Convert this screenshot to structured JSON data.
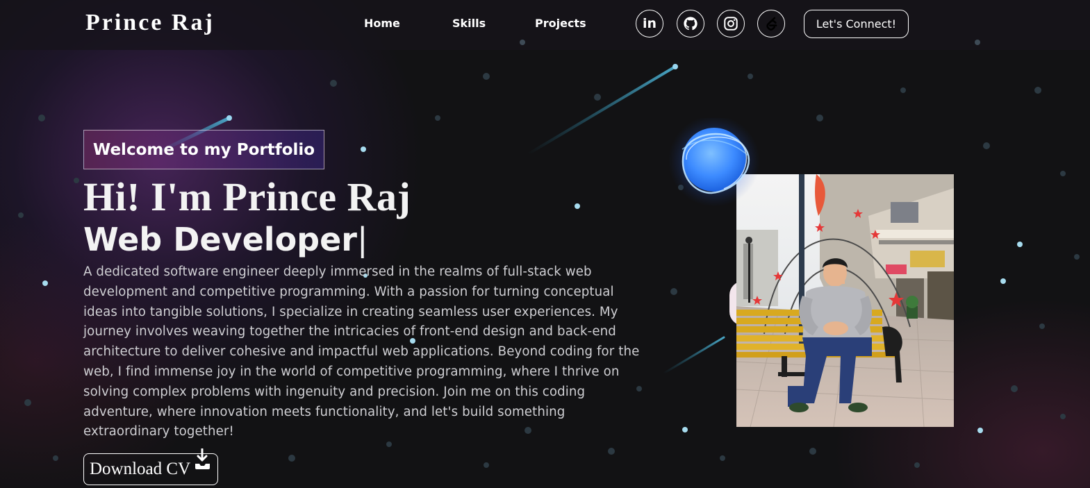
{
  "navbar": {
    "logo": "Prince Raj",
    "links": [
      {
        "label": "Home"
      },
      {
        "label": "Skills"
      },
      {
        "label": "Projects"
      }
    ],
    "socials": [
      {
        "icon": "linkedin-icon",
        "text": "in"
      },
      {
        "icon": "github-icon"
      },
      {
        "icon": "instagram-icon"
      },
      {
        "icon": "leetcode-icon"
      }
    ],
    "connect_label": "Let's Connect!"
  },
  "hero": {
    "tagline": "Welcome to my Portfolio",
    "greeting": "Hi! I'm Prince Raj",
    "role": "Web Developer",
    "cursor": "|",
    "bio": "A dedicated software engineer deeply immersed in the realms of full-stack web development and competitive programming. With a passion for turning conceptual ideas into tangible solutions, I specialize in creating seamless user experiences. My journey involves weaving together the intricacies of front-end design and back-end architecture to deliver cohesive and impactful web applications. Beyond coding for the web, I find immense joy in the world of competitive programming, where I thrive on solving complex problems with ingenuity and precision. Join me on this coding adventure, where innovation meets functionality, and let's build something extraordinary together!",
    "download_label": "Download CV"
  },
  "colors": {
    "background": "#121214",
    "accent_pink": "#aa367c",
    "accent_purple": "#4a2fbd",
    "orb_blue": "#3d8bff",
    "text_muted": "#cfcfd3"
  }
}
